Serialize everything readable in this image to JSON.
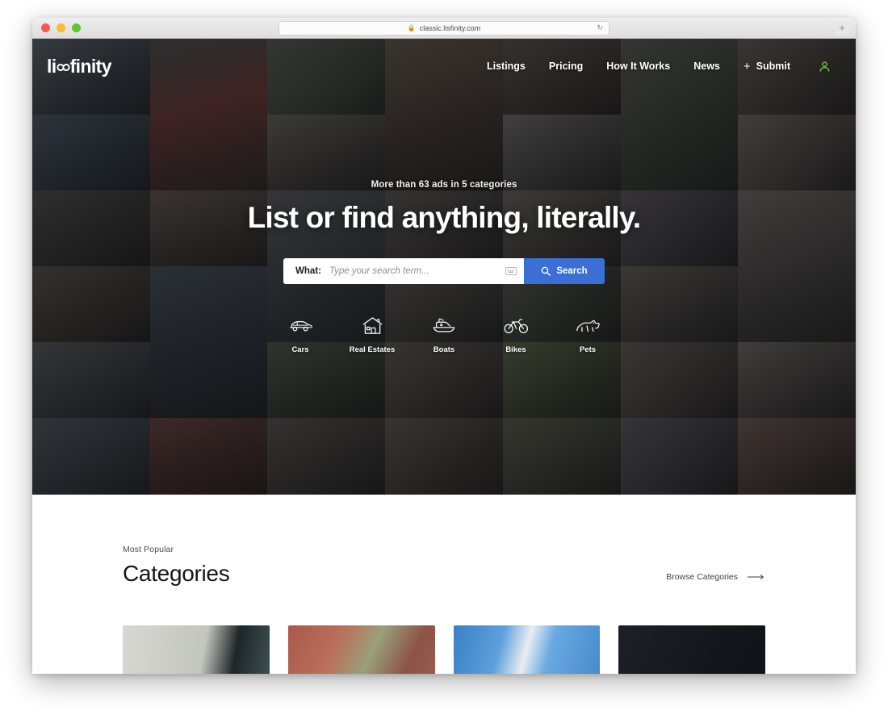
{
  "browser": {
    "url": "classic.lisfinity.com",
    "lock_icon": "lock-icon",
    "reload_icon": "reload-icon",
    "new_tab_icon": "plus-icon",
    "traffic_lights": [
      "close-red",
      "minimize-yellow",
      "maximize-green"
    ]
  },
  "header": {
    "logo_prefix": "li",
    "logo_suffix": "finity",
    "logo_mark_icon": "infinity-icon",
    "nav": [
      {
        "label": "Listings",
        "name": "nav-listings"
      },
      {
        "label": "Pricing",
        "name": "nav-pricing"
      },
      {
        "label": "How It Works",
        "name": "nav-how-it-works"
      },
      {
        "label": "News",
        "name": "nav-news"
      }
    ],
    "submit_label": "Submit",
    "submit_plus": "+",
    "avatar_icon": "user-icon",
    "avatar_color": "#6fbf4a"
  },
  "hero": {
    "kicker": "More than 63 ads in 5 categories",
    "title": "List or find anything, literally.",
    "search": {
      "label": "What:",
      "placeholder": "Type your search term...",
      "value": "",
      "keyboard_icon": "keyboard-icon",
      "button_label": "Search",
      "button_icon": "search-icon",
      "button_color": "#3b6fd6"
    },
    "categories": [
      {
        "label": "Cars",
        "icon": "car-icon"
      },
      {
        "label": "Real Estates",
        "icon": "house-icon"
      },
      {
        "label": "Boats",
        "icon": "boat-icon"
      },
      {
        "label": "Bikes",
        "icon": "bicycle-icon"
      },
      {
        "label": "Pets",
        "icon": "dog-icon"
      }
    ]
  },
  "categories_section": {
    "kicker": "Most Popular",
    "title": "Categories",
    "browse_label": "Browse Categories",
    "browse_icon": "arrow-right-icon",
    "cards": [
      {
        "name": "category-card-1"
      },
      {
        "name": "category-card-2"
      },
      {
        "name": "category-card-3"
      },
      {
        "name": "category-card-4"
      }
    ]
  }
}
